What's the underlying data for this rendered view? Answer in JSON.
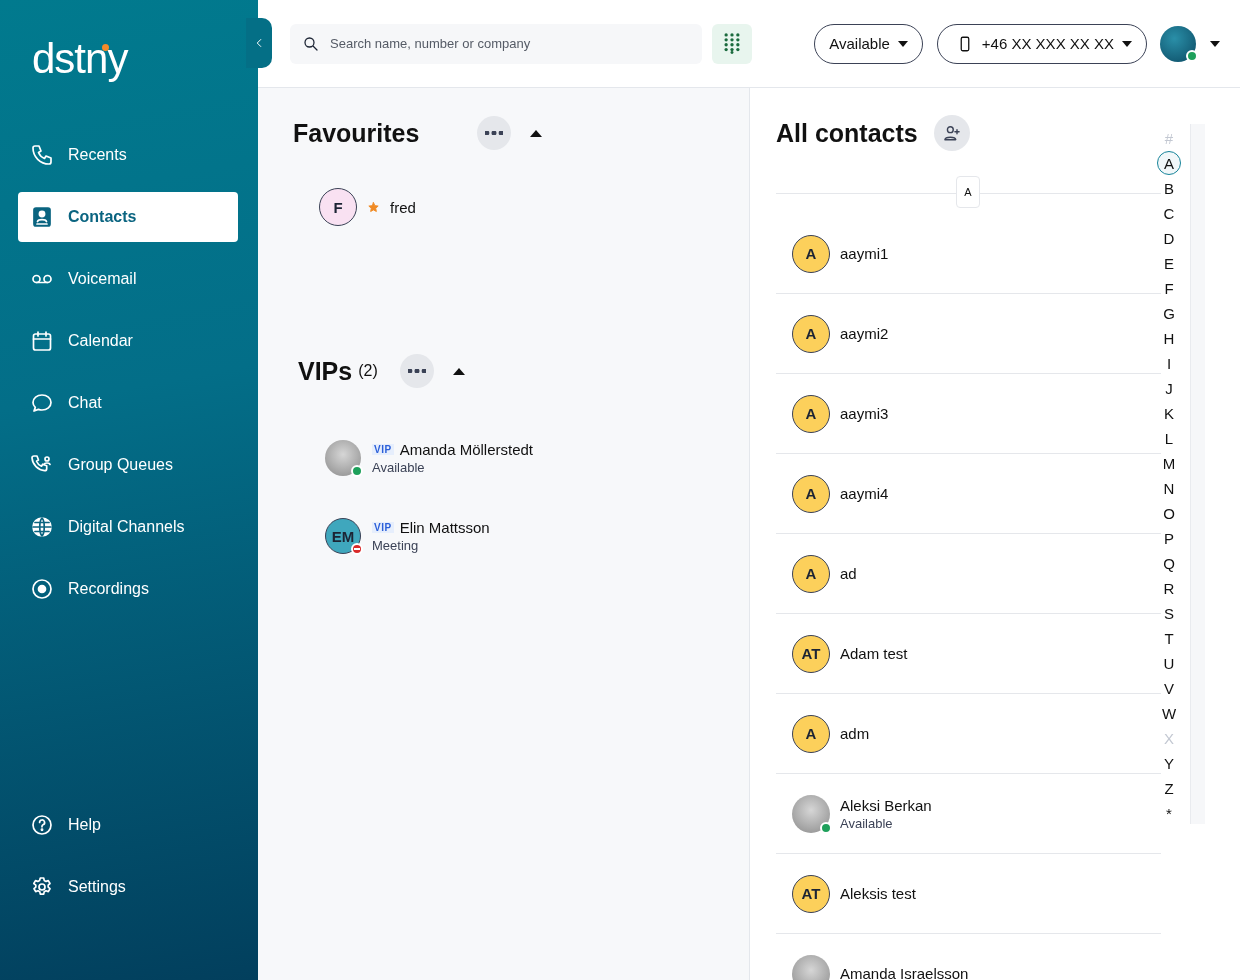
{
  "sidebar": {
    "logo": "dstny",
    "items": [
      {
        "label": "Recents",
        "selected": false
      },
      {
        "label": "Contacts",
        "selected": true
      },
      {
        "label": "Voicemail",
        "selected": false
      },
      {
        "label": "Calendar",
        "selected": false
      },
      {
        "label": "Chat",
        "selected": false
      },
      {
        "label": "Group Queues",
        "selected": false
      },
      {
        "label": "Digital Channels",
        "selected": false
      },
      {
        "label": "Recordings",
        "selected": false
      }
    ],
    "bottom_items": [
      {
        "label": "Help",
        "selected": false
      },
      {
        "label": "Settings",
        "selected": false
      }
    ]
  },
  "topbar": {
    "search": {
      "placeholder": "Search name, number or company"
    },
    "status": "Available",
    "phone": "+46 XX XXX XX XX",
    "status_dot": {
      "kind": "dot",
      "color": "#1ea05b"
    }
  },
  "favourites": {
    "title": "Favourites",
    "expanded": true,
    "contacts": [
      {
        "kind": "initials",
        "initials": "F",
        "color": "#f9e1f2",
        "name": "fred",
        "starred": true
      }
    ]
  },
  "vips": {
    "title": "VIPs",
    "count": "(2)",
    "expanded": true,
    "contacts": [
      {
        "kind": "photo",
        "badge": "VIP",
        "name": "Amanda Möllerstedt",
        "status": "Available",
        "status_dot": {
          "kind": "dot",
          "color": "#1ea05b"
        }
      },
      {
        "kind": "initials",
        "initials": "EM",
        "color": "#3fa7bd",
        "badge": "VIP",
        "name": "Elin Mattsson",
        "status": "Meeting",
        "status_dot": {
          "kind": "minus",
          "color": "#d92a2a"
        }
      }
    ]
  },
  "all_contacts": {
    "title": "All contacts",
    "section_letter": "A",
    "contacts": [
      {
        "kind": "initials",
        "initials": "A",
        "color": "#fcd05b",
        "name": "aaymi1"
      },
      {
        "kind": "initials",
        "initials": "A",
        "color": "#fcd05b",
        "name": "aaymi2"
      },
      {
        "kind": "initials",
        "initials": "A",
        "color": "#fcd05b",
        "name": "aaymi3"
      },
      {
        "kind": "initials",
        "initials": "A",
        "color": "#fcd05b",
        "name": "aaymi4"
      },
      {
        "kind": "initials",
        "initials": "A",
        "color": "#fcd05b",
        "name": "ad"
      },
      {
        "kind": "initials",
        "initials": "AT",
        "color": "#fcd05b",
        "name": "Adam test"
      },
      {
        "kind": "initials",
        "initials": "A",
        "color": "#fcd05b",
        "name": "adm"
      },
      {
        "kind": "photo",
        "name": "Aleksi Berkan",
        "status": "Available",
        "status_dot": {
          "kind": "dot",
          "color": "#1ea05b"
        }
      },
      {
        "kind": "initials",
        "initials": "AT",
        "color": "#fcd05b",
        "name": "Aleksis test"
      },
      {
        "kind": "photo",
        "name": "Amanda Israelsson"
      }
    ],
    "index": [
      {
        "letter": "#",
        "selected": false,
        "disabled": true
      },
      {
        "letter": "A",
        "selected": true,
        "disabled": false
      },
      {
        "letter": "B",
        "selected": false,
        "disabled": false
      },
      {
        "letter": "C",
        "selected": false,
        "disabled": false
      },
      {
        "letter": "D",
        "selected": false,
        "disabled": false
      },
      {
        "letter": "E",
        "selected": false,
        "disabled": false
      },
      {
        "letter": "F",
        "selected": false,
        "disabled": false
      },
      {
        "letter": "G",
        "selected": false,
        "disabled": false
      },
      {
        "letter": "H",
        "selected": false,
        "disabled": false
      },
      {
        "letter": "I",
        "selected": false,
        "disabled": false
      },
      {
        "letter": "J",
        "selected": false,
        "disabled": false
      },
      {
        "letter": "K",
        "selected": false,
        "disabled": false
      },
      {
        "letter": "L",
        "selected": false,
        "disabled": false
      },
      {
        "letter": "M",
        "selected": false,
        "disabled": false
      },
      {
        "letter": "N",
        "selected": false,
        "disabled": false
      },
      {
        "letter": "O",
        "selected": false,
        "disabled": false
      },
      {
        "letter": "P",
        "selected": false,
        "disabled": false
      },
      {
        "letter": "Q",
        "selected": false,
        "disabled": false
      },
      {
        "letter": "R",
        "selected": false,
        "disabled": false
      },
      {
        "letter": "S",
        "selected": false,
        "disabled": false
      },
      {
        "letter": "T",
        "selected": false,
        "disabled": false
      },
      {
        "letter": "U",
        "selected": false,
        "disabled": false
      },
      {
        "letter": "V",
        "selected": false,
        "disabled": false
      },
      {
        "letter": "W",
        "selected": false,
        "disabled": false
      },
      {
        "letter": "X",
        "selected": false,
        "disabled": true
      },
      {
        "letter": "Y",
        "selected": false,
        "disabled": false
      },
      {
        "letter": "Z",
        "selected": false,
        "disabled": false
      },
      {
        "letter": "*",
        "selected": false,
        "disabled": false
      }
    ]
  }
}
